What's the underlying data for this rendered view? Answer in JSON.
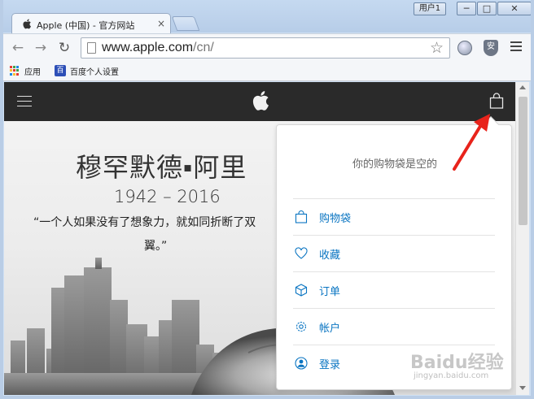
{
  "window": {
    "user_label": "用户1",
    "minimize_glyph": "─",
    "maximize_glyph": "□",
    "close_glyph": "✕"
  },
  "tab": {
    "title": "Apple (中国) - 官方网站",
    "close_glyph": "×",
    "favicon": "apple-icon"
  },
  "toolbar": {
    "back_glyph": "←",
    "forward_glyph": "→",
    "reload_glyph": "↻",
    "url_host": "www.apple.com",
    "url_path": "/cn/",
    "star_glyph": "☆",
    "ext2_glyph": "安"
  },
  "bookmarks": [
    {
      "label": "应用",
      "icon": "apps-grid-icon"
    },
    {
      "label": "百度个人设置",
      "icon": "baidu-paw-icon",
      "icon_glyph": "百"
    }
  ],
  "hero": {
    "title": "穆罕默德▪阿里",
    "years": "1942 – 2016",
    "quote_line1": "“一个人如果没有了想象力，就如同折断了双",
    "quote_line2": "翼。”"
  },
  "bag_flyout": {
    "empty_message": "你的购物袋是空的",
    "items": [
      {
        "label": "购物袋",
        "icon": "bag-icon"
      },
      {
        "label": "收藏",
        "icon": "heart-icon"
      },
      {
        "label": "订单",
        "icon": "box-icon"
      },
      {
        "label": "帐户",
        "icon": "gear-icon"
      },
      {
        "label": "登录",
        "icon": "person-icon"
      }
    ]
  },
  "watermark": {
    "main": "Baidu经验",
    "sub": "jingyan.baidu.com"
  },
  "colors": {
    "link_blue": "#0a75c2",
    "nav_dark": "#2a2a2a",
    "annotation_red": "#e8231b"
  }
}
